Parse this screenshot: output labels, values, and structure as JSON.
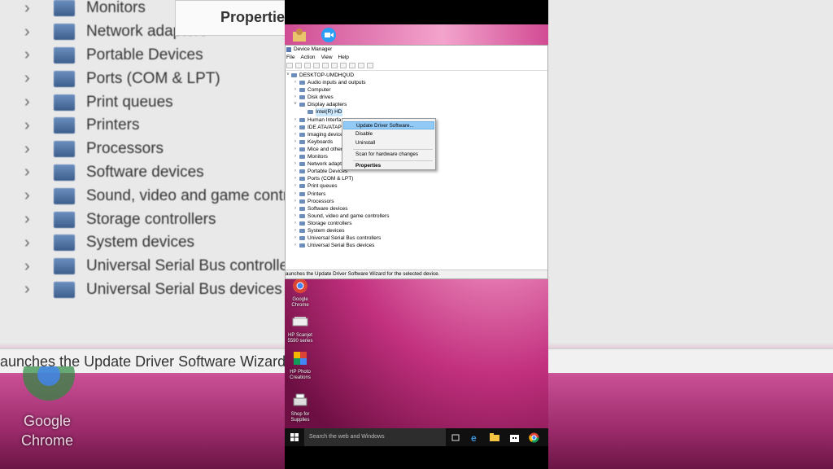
{
  "background": {
    "items": [
      "Monitors",
      "Network adapters",
      "Portable Devices",
      "Ports (COM & LPT)",
      "Print queues",
      "Printers",
      "Processors",
      "Software devices",
      "Sound, video and game controllers",
      "Storage controllers",
      "System devices",
      "Universal Serial Bus controllers",
      "Universal Serial Bus devices"
    ],
    "properties": "Propertie",
    "status": "aunches the Update Driver Software Wizard",
    "chrome_label": "Google Chrome"
  },
  "window": {
    "title": "Device Manager",
    "menu": [
      "File",
      "Action",
      "View",
      "Help"
    ],
    "root": "DESKTOP-UMDHQUD",
    "tree": [
      {
        "label": "Audio inputs and outputs",
        "level": 1,
        "chev": "›"
      },
      {
        "label": "Computer",
        "level": 1,
        "chev": "›"
      },
      {
        "label": "Disk drives",
        "level": 1,
        "chev": "›"
      },
      {
        "label": "Display adapters",
        "level": 1,
        "chev": "˅"
      },
      {
        "label": "Intel(R) HD",
        "level": 2,
        "chev": "",
        "selected": true
      },
      {
        "label": "Human Interfa",
        "level": 1,
        "chev": "›"
      },
      {
        "label": "IDE ATA/ATAPI",
        "level": 1,
        "chev": "›"
      },
      {
        "label": "Imaging device",
        "level": 1,
        "chev": "›"
      },
      {
        "label": "Keyboards",
        "level": 1,
        "chev": "›"
      },
      {
        "label": "Mice and other",
        "level": 1,
        "chev": "›"
      },
      {
        "label": "Monitors",
        "level": 1,
        "chev": "›"
      },
      {
        "label": "Network adapte",
        "level": 1,
        "chev": "›"
      },
      {
        "label": "Portable Devices",
        "level": 1,
        "chev": "›"
      },
      {
        "label": "Ports (COM & LPT)",
        "level": 1,
        "chev": "›"
      },
      {
        "label": "Print queues",
        "level": 1,
        "chev": "›"
      },
      {
        "label": "Printers",
        "level": 1,
        "chev": "›"
      },
      {
        "label": "Processors",
        "level": 1,
        "chev": "›"
      },
      {
        "label": "Software devices",
        "level": 1,
        "chev": "›"
      },
      {
        "label": "Sound, video and game controllers",
        "level": 1,
        "chev": "›"
      },
      {
        "label": "Storage controllers",
        "level": 1,
        "chev": "›"
      },
      {
        "label": "System devices",
        "level": 1,
        "chev": "›"
      },
      {
        "label": "Universal Serial Bus controllers",
        "level": 1,
        "chev": "›"
      },
      {
        "label": "Universal Serial Bus devices",
        "level": 1,
        "chev": "›"
      }
    ],
    "context_menu": {
      "update": "Update Driver Software...",
      "disable": "Disable",
      "uninstall": "Uninstall",
      "scan": "Scan for hardware changes",
      "properties": "Properties"
    },
    "status": "aunches the Update Driver Software Wizard for the selected device."
  },
  "desktop_icons": [
    {
      "label": "Google Chrome",
      "icon": "chrome-icon"
    },
    {
      "label": "HP Scanjet 5590 series",
      "icon": "scanner-icon"
    },
    {
      "label": "HP Photo Creations",
      "icon": "photo-creations-icon"
    },
    {
      "label": "Shop for Supplies",
      "icon": "printer-supplies-icon"
    }
  ],
  "taskbar": {
    "search_placeholder": "Search the web and Windows"
  },
  "colors": {
    "highlight": "#91c9f7",
    "selection": "#cce8ff",
    "taskbar": "#101010",
    "wallpaper": "#c2307e"
  }
}
